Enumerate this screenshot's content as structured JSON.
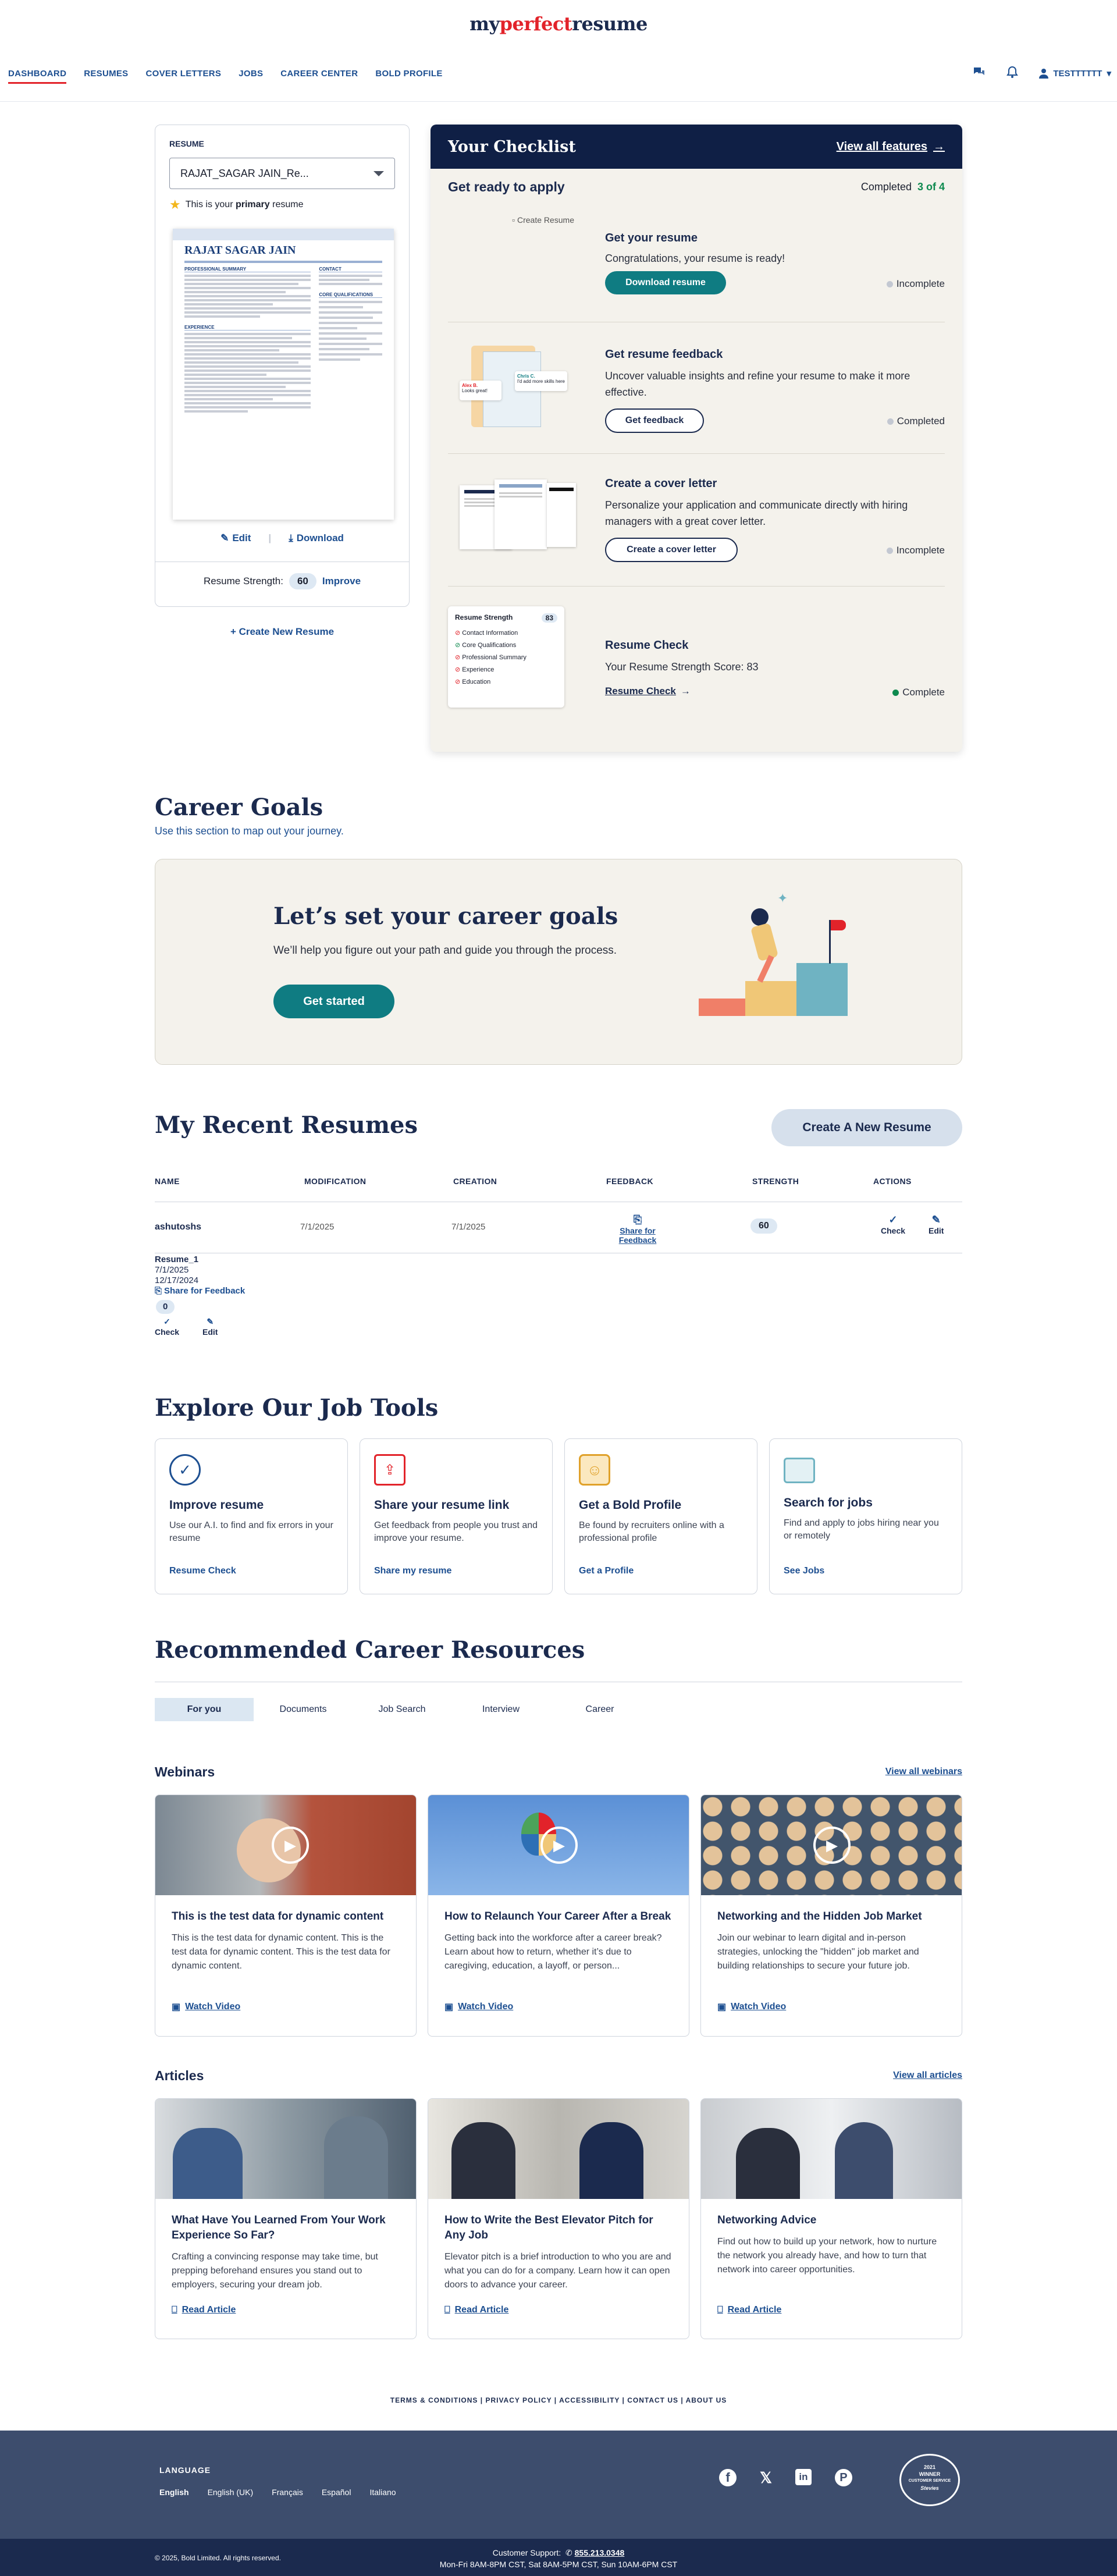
{
  "brand": {
    "pre": "my",
    "mid": "perfect",
    "post": "resume"
  },
  "nav": [
    "DASHBOARD",
    "RESUMES",
    "COVER LETTERS",
    "JOBS",
    "CAREER CENTER",
    "BOLD PROFILE"
  ],
  "user": "TESTTTTTT",
  "resume_panel": {
    "label": "RESUME",
    "selected": "RAJAT_SAGAR JAIN_Re...",
    "primary_pre": "This is your",
    "primary_bold": "primary",
    "primary_post": "resume",
    "preview_name": "RAJAT SAGAR JAIN",
    "preview_sections": [
      "PROFESSIONAL SUMMARY",
      "CONTACT",
      "CORE QUALIFICATIONS",
      "EXPERIENCE"
    ],
    "edit": "Edit",
    "download": "Download",
    "strength_label": "Resume Strength:",
    "strength": "60",
    "improve": "Improve",
    "create_new": "+ Create New Resume"
  },
  "checklist": {
    "title": "Your Checklist",
    "view_all": "View all features",
    "subtitle": "Get ready to apply",
    "completed_label": "Completed",
    "completed_count": "3 of 4",
    "items": [
      {
        "title": "Get your resume",
        "desc": "Congratulations, your resume is ready!",
        "button": "Download resume",
        "status": "Incomplete",
        "img_alt": "Create Resume"
      },
      {
        "title": "Get resume feedback",
        "desc": "Uncover valuable insights and refine your resume to make it more effective.",
        "button": "Get feedback",
        "status": "Completed"
      },
      {
        "title": "Create a cover letter",
        "desc": "Personalize your application and communicate directly with hiring managers with a great cover letter.",
        "button": "Create a cover letter",
        "status": "Incomplete"
      },
      {
        "title": "Resume Check",
        "desc": "Your Resume Strength Score: 83",
        "button": "Resume Check",
        "status": "Complete",
        "thumb": {
          "title": "Resume Strength",
          "score": "83",
          "rows": [
            "Contact Information",
            "Core Qualifications",
            "Professional Summary",
            "Experience",
            "Education"
          ]
        }
      }
    ],
    "feedback_thumb": {
      "a": "Alex B.",
      "a_msg": "Looks great!",
      "b": "Chris C.",
      "b_msg": "I'd add more skills here"
    }
  },
  "career_goals": {
    "title": "Career Goals",
    "subtitle": "Use this section to map out your journey.",
    "heading": "Let’s set your career goals",
    "text": "We’ll help you figure out your path and guide you through the process.",
    "button": "Get started"
  },
  "recent": {
    "title": "My Recent Resumes",
    "create_button": "Create A New Resume",
    "columns": [
      "NAME",
      "MODIFICATION",
      "CREATION",
      "FEEDBACK",
      "STRENGTH",
      "ACTIONS"
    ],
    "rows": [
      {
        "name": "ashutoshs",
        "mod": "7/1/2025",
        "created": "7/1/2025",
        "feedback": "Share for Feedback",
        "strength": "60",
        "check": "Check",
        "edit": "Edit"
      }
    ],
    "second": {
      "name": "Resume_1",
      "mod": "7/1/2025",
      "created": "12/17/2024",
      "feedback": "Share for Feedback",
      "strength": "0",
      "check": "Check",
      "edit": "Edit"
    }
  },
  "tools": {
    "title": "Explore Our Job Tools",
    "items": [
      {
        "title": "Improve resume",
        "desc": "Use our A.I. to find and fix errors in your resume",
        "link": "Resume Check",
        "icon": "check-badge-icon"
      },
      {
        "title": "Share your resume link",
        "desc": "Get feedback from people you trust and improve your resume.",
        "link": "Share my resume",
        "icon": "share-doc-icon"
      },
      {
        "title": "Get a Bold Profile",
        "desc": "Be found by recruiters online with a professional profile",
        "link": "Get a Profile",
        "icon": "profile-icon"
      },
      {
        "title": "Search for jobs",
        "desc": "Find and apply to jobs hiring near you or remotely",
        "link": "See Jobs",
        "icon": "briefcase-icon"
      }
    ]
  },
  "resources": {
    "title": "Recommended Career Resources",
    "tabs": [
      "For you",
      "Documents",
      "Job Search",
      "Interview",
      "Career"
    ],
    "webinars_label": "Webinars",
    "webinars_all": "View all webinars",
    "webinars": [
      {
        "title": "This is the test data for dynamic content",
        "desc": "This is the test data for dynamic content. This is the test data for dynamic content. This is the test data for dynamic content.",
        "link": "Watch Video"
      },
      {
        "title": "How to Relaunch Your Career After a Break",
        "desc": "Getting back into the workforce after a career break? Learn about how to return, whether it’s due to caregiving, education, a layoff, or person...",
        "link": "Watch Video"
      },
      {
        "title": "Networking and the Hidden Job Market",
        "desc": "Join our webinar to learn digital and in-person strategies, unlocking the \"hidden\" job market and building relationships to secure your future job.",
        "link": "Watch Video"
      }
    ],
    "articles_label": "Articles",
    "articles_all": "View all articles",
    "articles": [
      {
        "title": "What Have You Learned From Your Work Experience So Far?",
        "desc": "Crafting a convincing response may take time, but prepping beforehand ensures you stand out to employers, securing your dream job.",
        "link": "Read Article"
      },
      {
        "title": "How to Write the Best Elevator Pitch for Any Job",
        "desc": "Elevator pitch is a brief introduction to who you are and what you can do for a company. Learn how it can open doors to advance your career.",
        "link": "Read Article"
      },
      {
        "title": "Networking Advice",
        "desc": "Find out how to build up your network, how to nurture the network you already have, and how to turn that network into career opportunities.",
        "link": "Read Article"
      }
    ]
  },
  "footer_links": [
    "TERMS & CONDITIONS",
    "PRIVACY POLICY",
    "ACCESSIBILITY",
    "CONTACT US",
    "ABOUT US"
  ],
  "footer": {
    "language_label": "LANGUAGE",
    "languages": [
      "English",
      "English (UK)",
      "Français",
      "Español",
      "Italiano"
    ],
    "copyright": "© 2025, Bold Limited. All rights reserved.",
    "support_label": "Customer Support:",
    "phone": "855.213.0348",
    "hours": "Mon-Fri 8AM-8PM CST, Sat 8AM-5PM CST, Sun 10AM-6PM CST",
    "award": {
      "year": "2021",
      "line1": "WINNER",
      "line2": "CUSTOMER SERVICE",
      "line3": "Stevies"
    }
  },
  "colors": {
    "navy": "#1b2a4e",
    "teal": "#0f7c82",
    "red": "#e2232a",
    "link": "#1d4f91",
    "beige": "#f4f2ec"
  }
}
